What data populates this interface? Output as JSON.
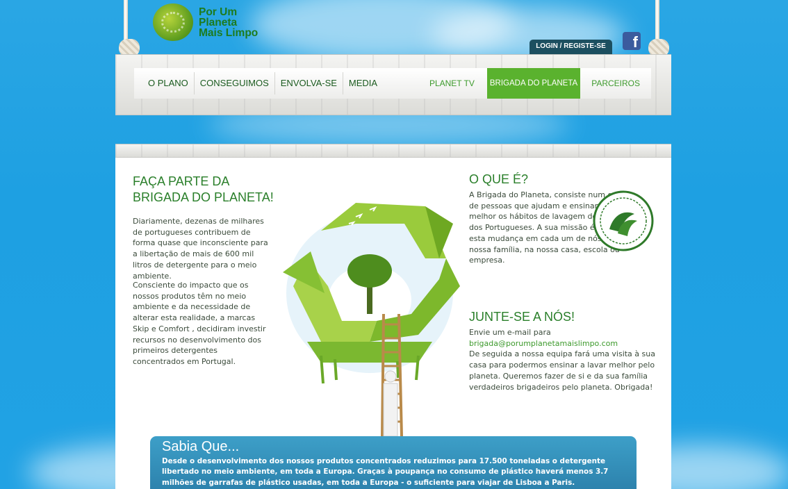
{
  "logo": {
    "lines": [
      "Por Um",
      "Planeta",
      "Mais Limpo"
    ]
  },
  "header": {
    "login_label": "LOGIN / REGISTE-SE",
    "facebook_glyph": "f"
  },
  "nav": {
    "left": [
      "O PLANO",
      "CONSEGUIMOS",
      "ENVOLVA-SE",
      "MEDIA"
    ],
    "right": [
      "PLANET TV",
      "BRIGADA DO PLANETA",
      "PARCEIROS"
    ],
    "active": "BRIGADA DO PLANETA"
  },
  "intro": {
    "title_line1": "FAÇA PARTE DA",
    "title_line2": "BRIGADA DO PLANETA!",
    "para1": "Diariamente, dezenas de milhares de portugueses contribuem de forma quase que inconsciente para a libertação de mais de 600 mil litros de detergente para o meio ambiente.",
    "para2": "Consciente do impacto que os nossos produtos têm no meio ambiente e da necessidade de alterar esta realidade, a marcas Skip e Comfort , decidiram investir recursos no desenvolvimento dos primeiros detergentes concentrados em Portugal."
  },
  "oque": {
    "title": "O QUE É?",
    "text": "A Brigada do Planeta, consiste num grupo de pessoas que ajudam e ensinam a melhor os hábitos de lavagem de roupa dos Portugueses. A sua missão é espalhar esta mudança em cada um de nós, pela nossa família, na nossa casa, escola ou empresa."
  },
  "junte": {
    "title": "JUNTE-SE A NÓS!",
    "lead": "Envie um e-mail para",
    "email": "brigada@porumplanetamaislimpo.com",
    "text": "De seguida a nossa equipa fará uma visita à sua casa para podermos ensinar a lavar melhor pelo planeta. Queremos fazer de si e da sua família verdadeiros brigadeiros pelo planeta. Obrigada!"
  },
  "sabia": {
    "title": "Sabia Que...",
    "text": "Desde o desenvolvimento dos nossos produtos concentrados reduzimos para 17.500 toneladas o detergente libertado no meio ambiente, em toda a Europa. Graças à poupança no consumo de plástico haverá menos 3.7 milhões de garrafas de plástico usadas, em toda a Europa - o suficiente para viajar de Lisboa a Paris."
  },
  "colors": {
    "brand_green": "#5ab22e",
    "sky": "#21a2e4",
    "login_bg": "#1c4f60",
    "sabia_bg": "#2a7da8"
  },
  "icons": [
    "globe-logo-icon",
    "facebook-icon",
    "brigada-badge-icon",
    "recycle-illustration",
    "brigada-seal-icon"
  ]
}
